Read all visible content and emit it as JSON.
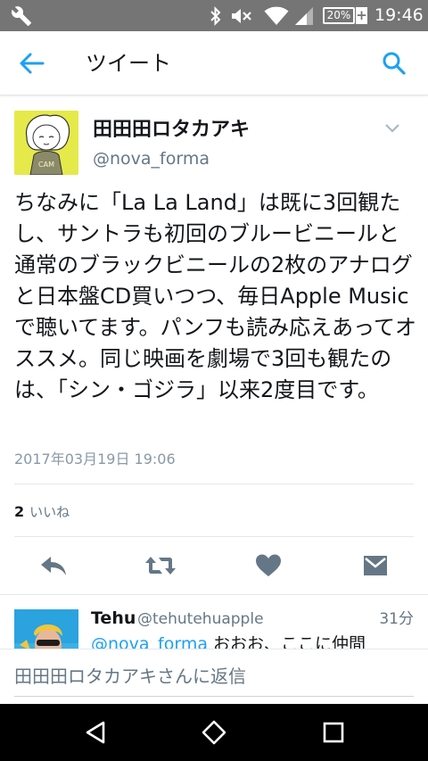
{
  "status_bar": {
    "time": "19:46",
    "battery_percent": "20%",
    "battery_plus": "+",
    "icons": [
      "wrench-icon",
      "bluetooth-icon",
      "mute-icon",
      "wifi-icon",
      "signal-icon",
      "battery-icon"
    ]
  },
  "app_bar": {
    "title": "ツイート",
    "back_icon": "back-arrow-icon",
    "search_icon": "search-icon"
  },
  "author": {
    "display_name": "田田田ロタカアキ",
    "handle": "@nova_forma"
  },
  "tweet": {
    "text": "ちなみに「La La Land」は既に3回観たし、サントラも初回のブルービニールと通常のブラックビニールの2枚のアナログと日本盤CD買いつつ、毎日Apple Musicで聴いてます。パンフも読み応えあってオススメ。同じ映画を劇場で3回も観たのは、「シン・ゴジラ」以来2度目です。",
    "timestamp": "2017年03月19日 19:06",
    "likes_count": "2",
    "likes_label": "いいね"
  },
  "actions": [
    {
      "name": "reply-icon"
    },
    {
      "name": "retweet-icon"
    },
    {
      "name": "like-icon"
    },
    {
      "name": "direct-message-icon"
    }
  ],
  "reply": {
    "display_name": "Tehu",
    "handle": "@tehutehuapple",
    "time": "31分",
    "mention": "@nova_forma",
    "text": " おおお、ここに仲間"
  },
  "composer": {
    "placeholder": "田田田ロタカアキさんに返信"
  },
  "nav_bar": {
    "icons": [
      "back-triangle-icon",
      "home-circle-icon",
      "recents-square-icon"
    ]
  },
  "colors": {
    "accent": "#1da1f2",
    "status_bar": "#757575",
    "secondary_text": "#657786",
    "avatar_bg": "#e6e94a"
  }
}
